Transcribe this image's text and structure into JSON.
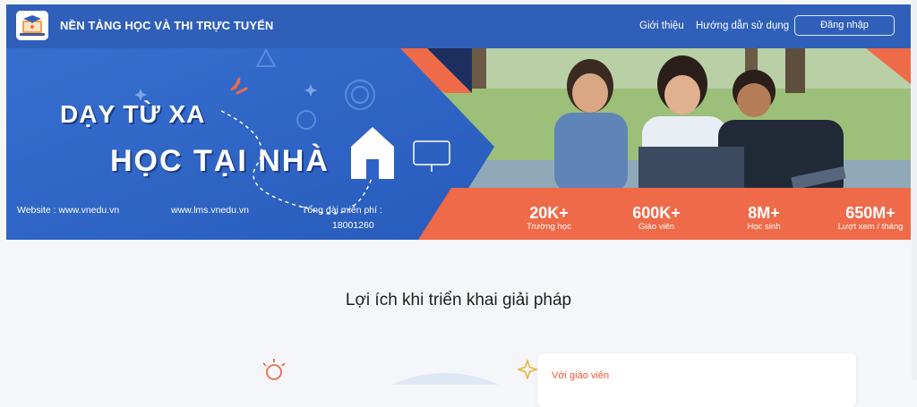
{
  "header": {
    "brand": "NỀN TẢNG HỌC VÀ THI TRỰC TUYẾN",
    "nav": [
      {
        "label": "Giới thiệu"
      },
      {
        "label": "Hướng dẫn sử dụng"
      }
    ],
    "login_label": "Đăng nhập",
    "logo_icon": "laptop-graduation-cap-icon"
  },
  "banner": {
    "headline_line1": "DẠY TỪ XA",
    "headline_line2": "HỌC TẠI NHÀ",
    "contacts": {
      "website1": "Website : www.vnedu.vn",
      "website2": "www.lms.vnedu.vn",
      "hotline_label": "Tổng đài miễn phí :",
      "hotline_number": "18001260"
    },
    "stats": [
      {
        "value": "20K+",
        "label": "Trường học"
      },
      {
        "value": "600K+",
        "label": "Giáo viên"
      },
      {
        "value": "8M+",
        "label": "Học sinh"
      },
      {
        "value": "650M+",
        "label": "Lượt xem / tháng"
      }
    ],
    "colors": {
      "blue": "#2d63c6",
      "orange": "#ef6a49",
      "dark_blue": "#1c3e86"
    }
  },
  "benefits": {
    "title": "Lợi ích khi triển khai giải pháp",
    "card_title": "Với giáo viên",
    "icons": [
      "lightbulb-icon",
      "sparkle-icon"
    ]
  },
  "colors": {
    "header_bg": "#2f5fb9",
    "page_bg": "#f4f6fa",
    "accent": "#f0562f"
  }
}
